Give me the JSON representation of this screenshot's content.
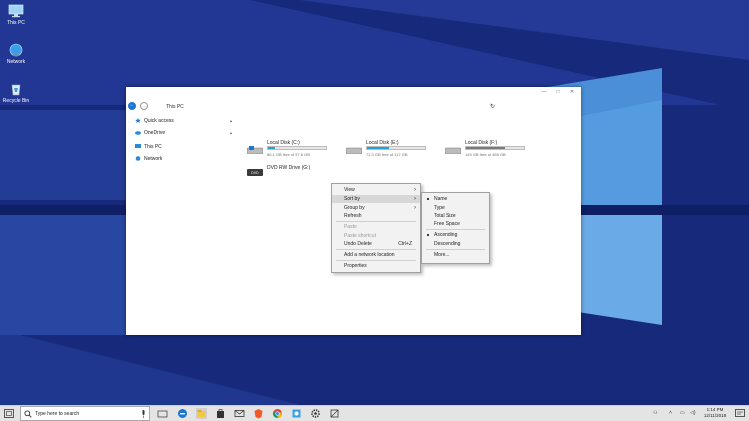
{
  "desktop": {
    "icons": [
      {
        "label": "This PC",
        "icon": "computer-icon"
      },
      {
        "label": "Network",
        "icon": "network-icon"
      },
      {
        "label": "Recycle Bin",
        "icon": "recycle-bin-icon"
      }
    ]
  },
  "explorer": {
    "address": "This PC",
    "nav": {
      "back": "←",
      "forward": "→",
      "refresh": "↻"
    },
    "window_controls": {
      "minimize": "—",
      "maximize": "□",
      "close": "✕"
    },
    "sidebar": [
      {
        "label": "Quick access",
        "icon": "star-icon",
        "color": "#1a78d2"
      },
      {
        "label": "OneDrive",
        "icon": "cloud-icon",
        "color": "#2a8ad8"
      },
      {
        "label": "This PC",
        "icon": "computer-icon",
        "color": "#2a8ad8"
      },
      {
        "label": "Network",
        "icon": "network-icon",
        "color": "#2a8ad8"
      }
    ],
    "drives": [
      {
        "name": "Local Disk (C:)",
        "info": "86.1 GB free of 97.6 GB",
        "used_fraction": 0.12,
        "accent": "#26a0da"
      },
      {
        "name": "Local Disk (E:)",
        "info": "72.3 GB free of 117 GB",
        "used_fraction": 0.38,
        "accent": "#26a0da"
      },
      {
        "name": "Local Disk (F:)",
        "info": "149 GB free of 465 GB",
        "used_fraction": 0.68,
        "accent": "#7a7a7a"
      }
    ],
    "dvd": {
      "name": "DVD RW Drive (G:)",
      "disc_label": "DVD"
    }
  },
  "context_menu": {
    "items": [
      "View",
      "Sort by",
      "Group by",
      "Refresh",
      "Paste",
      "Paste shortcut",
      "Undo Delete",
      "Add a network location",
      "Properties"
    ],
    "undo_shortcut": "Ctrl+Z",
    "submenu_arrow": "›"
  },
  "sort_submenu": {
    "items": [
      "Name",
      "Type",
      "Total Size",
      "Free Space",
      "Ascending",
      "Descending",
      "More..."
    ]
  },
  "taskbar": {
    "search_placeholder": "Type here to search",
    "clock_time": "1:14 PM",
    "clock_date": "12/11/2018",
    "task_view_glyph": "▭"
  },
  "colors": {
    "desktop_bg": "#1a2f7e",
    "accent": "#1a78d2"
  }
}
